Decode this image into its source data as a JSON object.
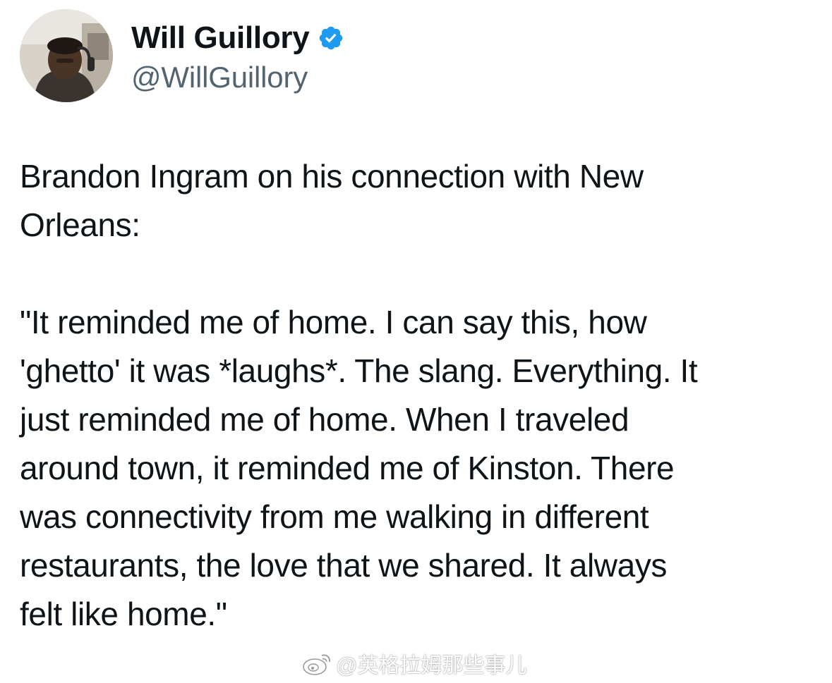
{
  "author": {
    "display_name": "Will Guillory",
    "handle": "@WillGuillory",
    "verified_icon": "verified-badge-icon",
    "verified_color": "#1d9bf0"
  },
  "tweet": {
    "intro": "Brandon Ingram on his connection with New\nOrleans:",
    "quote": "\"It reminded me of home. I can say this, how\n'ghetto' it was *laughs*. The slang. Everything. It\njust reminded me of home. When I traveled\naround town, it reminded me of Kinston. There\nwas connectivity from me walking in different\nrestaurants, the love that we shared. It always\nfelt like home.\""
  },
  "watermark": {
    "icon": "weibo-logo-icon",
    "text": "@英格拉姆那些事儿"
  },
  "colors": {
    "text_primary": "#0f1419",
    "text_secondary": "#536471",
    "background": "#ffffff"
  }
}
